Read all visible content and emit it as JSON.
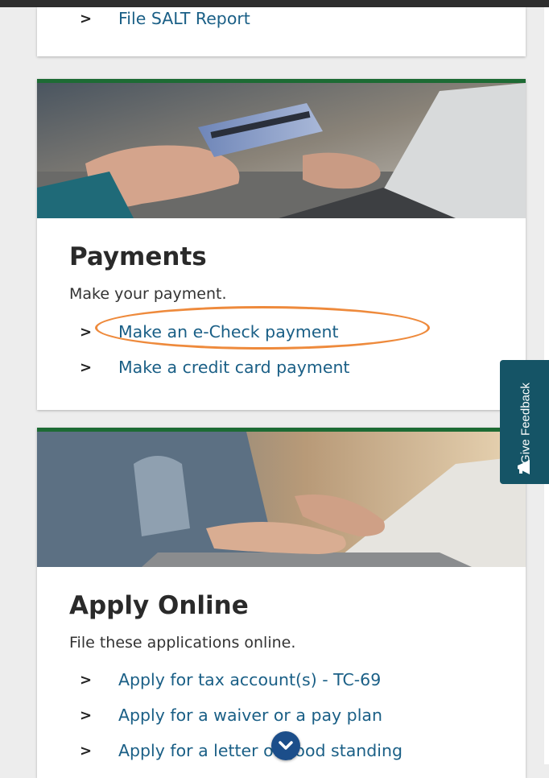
{
  "top_card": {
    "link_label": "File SALT Report"
  },
  "payments": {
    "title": "Payments",
    "description": "Make your payment.",
    "links": [
      {
        "label": "Make an e-Check payment"
      },
      {
        "label": "Make a credit card payment"
      }
    ]
  },
  "apply_online": {
    "title": "Apply Online",
    "description": "File these applications online.",
    "links": [
      {
        "label": "Apply for tax account(s) - TC-69"
      },
      {
        "label": "Apply for a waiver or a pay plan"
      },
      {
        "label": "Apply for a letter of good standing"
      }
    ]
  },
  "feedback_tab": {
    "label": "Give Feedback",
    "icon": "megaphone-icon"
  },
  "colors": {
    "accent_green": "#1d6b34",
    "link_blue": "#1a5f86",
    "highlight_orange": "#ee8a3c",
    "feedback_teal": "#155466"
  }
}
